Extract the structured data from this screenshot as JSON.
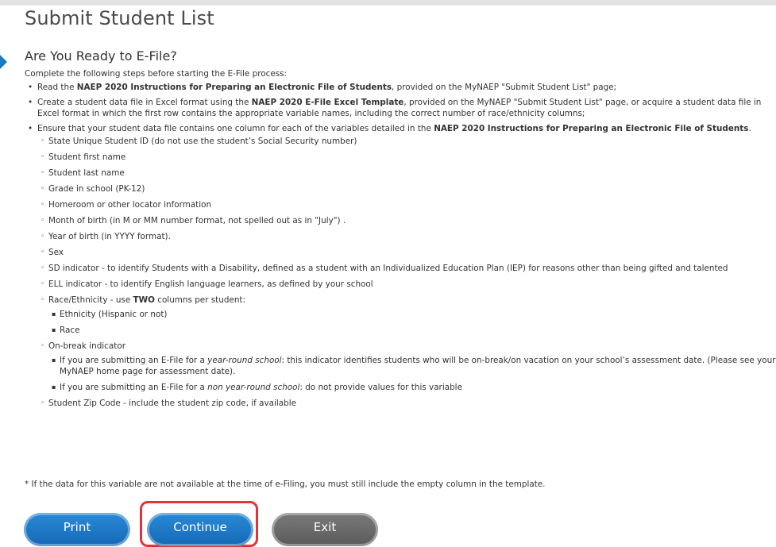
{
  "page": {
    "title": "Submit Student List",
    "heading": "Are You Ready to E-File?",
    "intro": "Complete the following steps before starting the E-File process:"
  },
  "steps": [
    {
      "pre": "Read the ",
      "bold": "NAEP 2020 Instructions for Preparing an Electronic File of Students",
      "post": ", provided on the MyNAEP \"Submit Student List\" page;"
    },
    {
      "pre": "Create a student data file in Excel format using the ",
      "bold": "NAEP 2020 E-File Excel Template",
      "post": ", provided on the MyNAEP \"Submit Student List\" page, or acquire a student data file in Excel format in which the first row contains the appropriate variable names, including the correct number of race/ethnicity columns;"
    },
    {
      "pre": "Ensure that your student data file contains one column for each of the variables detailed in the ",
      "bold": "NAEP 2020 Instructions for Preparing an Electronic File of Students",
      "post": "."
    }
  ],
  "variables": {
    "state_id": "State Unique Student ID (do not use the student’s Social Security number)",
    "first_name": "Student first name",
    "last_name": "Student last name",
    "grade": "Grade in school (PK-12)",
    "homeroom": "Homeroom or other locator information",
    "birth_month": "Month of birth (in M or MM number format, not spelled out as in \"July\") .",
    "birth_year": "Year of birth (in YYYY format).",
    "sex": "Sex",
    "sd": "SD indicator - to identify Students with a Disability, defined as a student with an Individualized Education Plan (IEP) for reasons other than being gifted and talented",
    "ell": "ELL indicator - to identify English language learners, as defined by your school",
    "race_pre": "Race/Ethnicity - use ",
    "race_bold": "TWO",
    "race_post": " columns per student:",
    "ethnicity": "Ethnicity (Hispanic or not)",
    "race": "Race",
    "onbreak": "On-break indicator",
    "yr_pre": "If you are submitting an E-File for a ",
    "yr_em": "year-round school",
    "yr_post": ": this indicator identifies students who will be on-break/on vacation on your school’s assessment date. (Please see your MyNAEP home page for assessment date).",
    "nyr_pre": "If you are submitting an E-File for a ",
    "nyr_em": "non year-round school",
    "nyr_post": ": do not provide values for this variable",
    "zip": "Student Zip Code - include the student zip code, if available"
  },
  "footnote": "* If the data for this variable are not available at the time of e-Filing, you must still include the empty column in the template.",
  "buttons": {
    "print": "Print",
    "continue": "Continue",
    "exit": "Exit"
  },
  "colors": {
    "primary_button": "#1a7bc3",
    "secondary_button": "#6a6a6a",
    "highlight": "#e0343c"
  }
}
